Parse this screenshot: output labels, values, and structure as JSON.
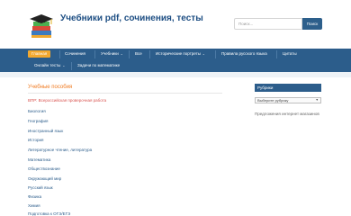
{
  "header": {
    "site_title": "Учебники pdf, сочинения, тесты",
    "search": {
      "placeholder": "Поиск...",
      "button_label": "Поиск"
    }
  },
  "nav": {
    "items": [
      {
        "label": "Главная",
        "active": true
      },
      {
        "label": "Сочинения"
      },
      {
        "label": "Учебники",
        "has_submenu": true
      },
      {
        "label": "Все"
      },
      {
        "label": "Исторические портреты",
        "has_submenu": true
      },
      {
        "label": "Правила русского языка"
      },
      {
        "label": "Цитаты"
      },
      {
        "label": "Онлайн тесты",
        "has_submenu": true
      },
      {
        "label": "Задачи по математике"
      }
    ]
  },
  "main": {
    "title": "Учебные пособия",
    "items": [
      "ВПР: Всероссийская проверочная работа",
      "Биология",
      "География",
      "Иностранный язык",
      "История",
      "Литературное чтение, литература",
      "Математика",
      "Обществознание",
      "Окружающий мир",
      "Русский язык",
      "Физика",
      "Химия",
      "Подготовка к ОГЭ/ЕГЭ"
    ]
  },
  "sidebar": {
    "title": "Рубрики",
    "select_value": "Выберите рубрику",
    "link": "Предложения интернет магазинов"
  },
  "colors": {
    "nav_bg": "#2c5d8b",
    "active_bg": "#f2a82f",
    "title_orange": "#f07a20",
    "link_blue": "#2c5d8b",
    "first_item_red": "#d9534f"
  }
}
